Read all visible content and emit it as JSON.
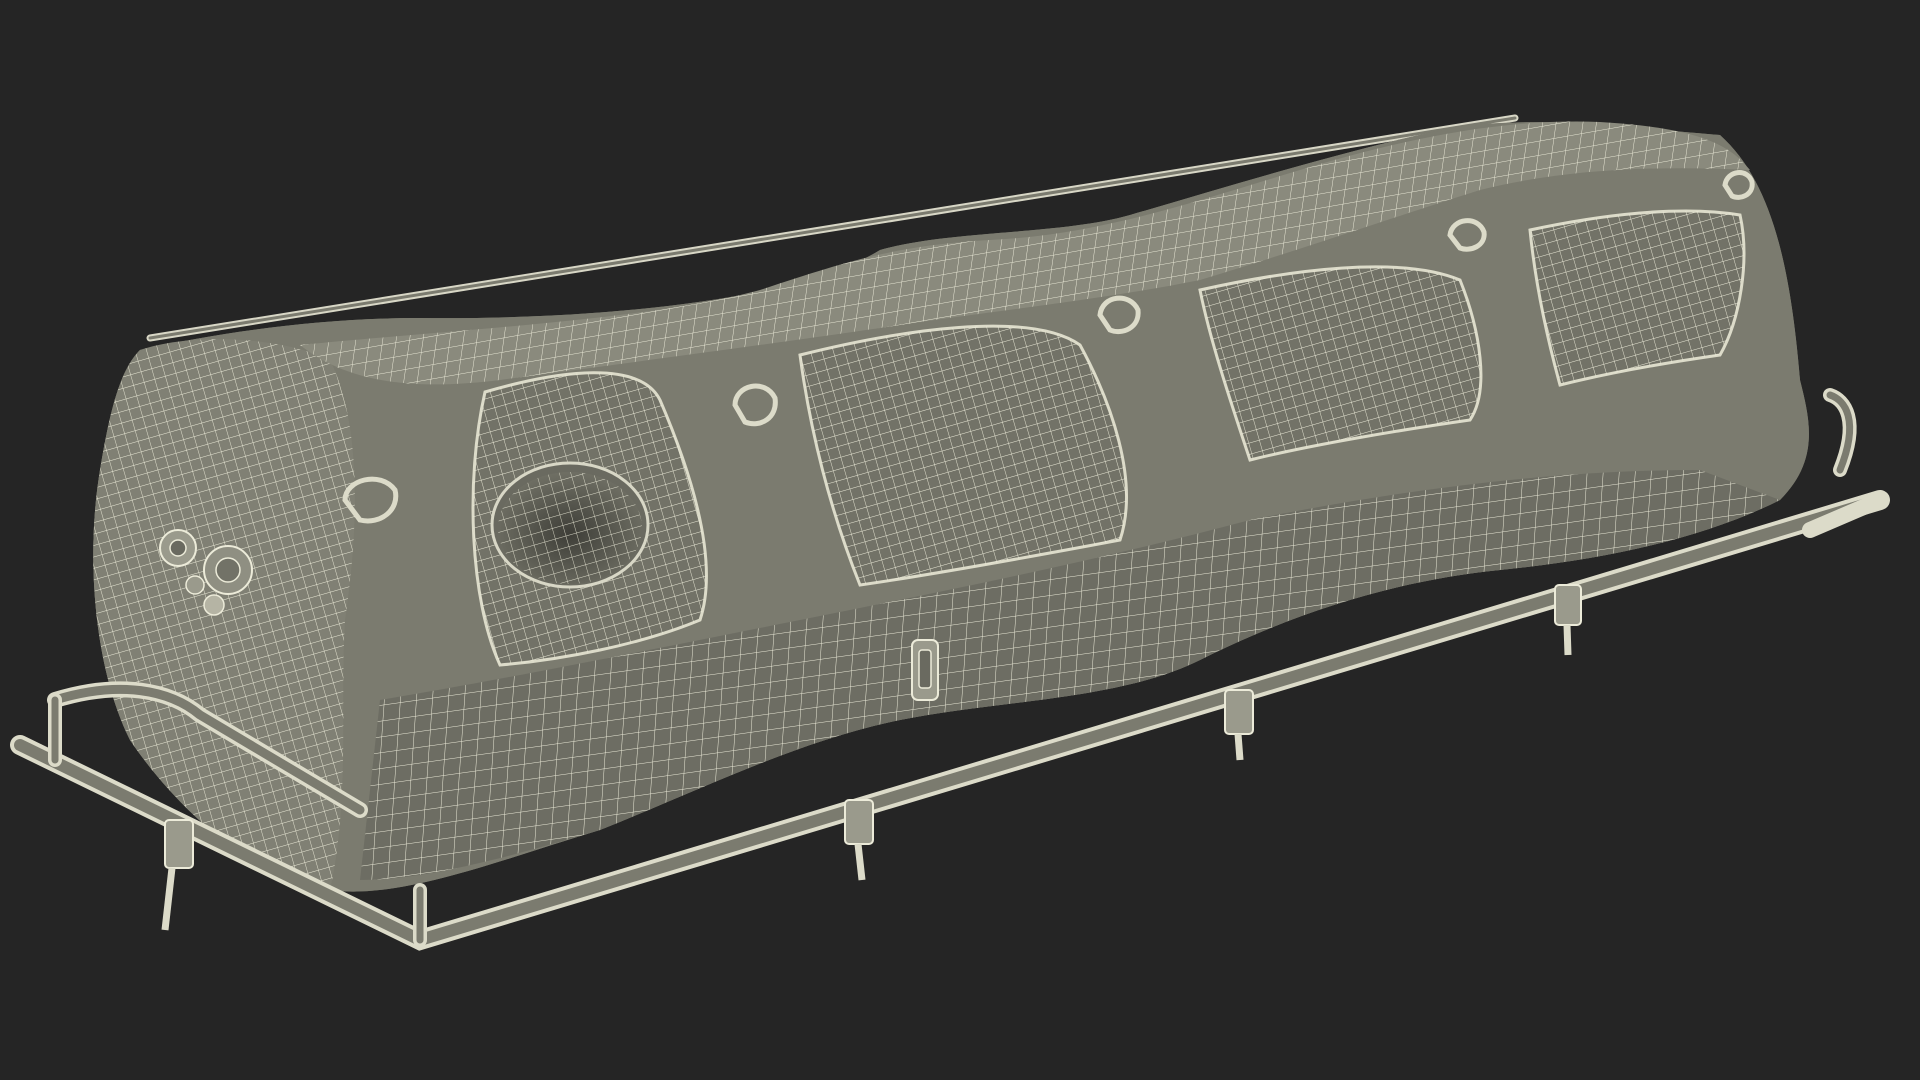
{
  "scene": {
    "subject": "wireframe-stretcher-model",
    "background_color": "#252525",
    "surface_color": "#7b7b6f",
    "shadow_color": "#5e5e54",
    "highlight_color": "#9a9a8c",
    "wire_color": "#ecebd9",
    "hole_color": "#505048"
  }
}
